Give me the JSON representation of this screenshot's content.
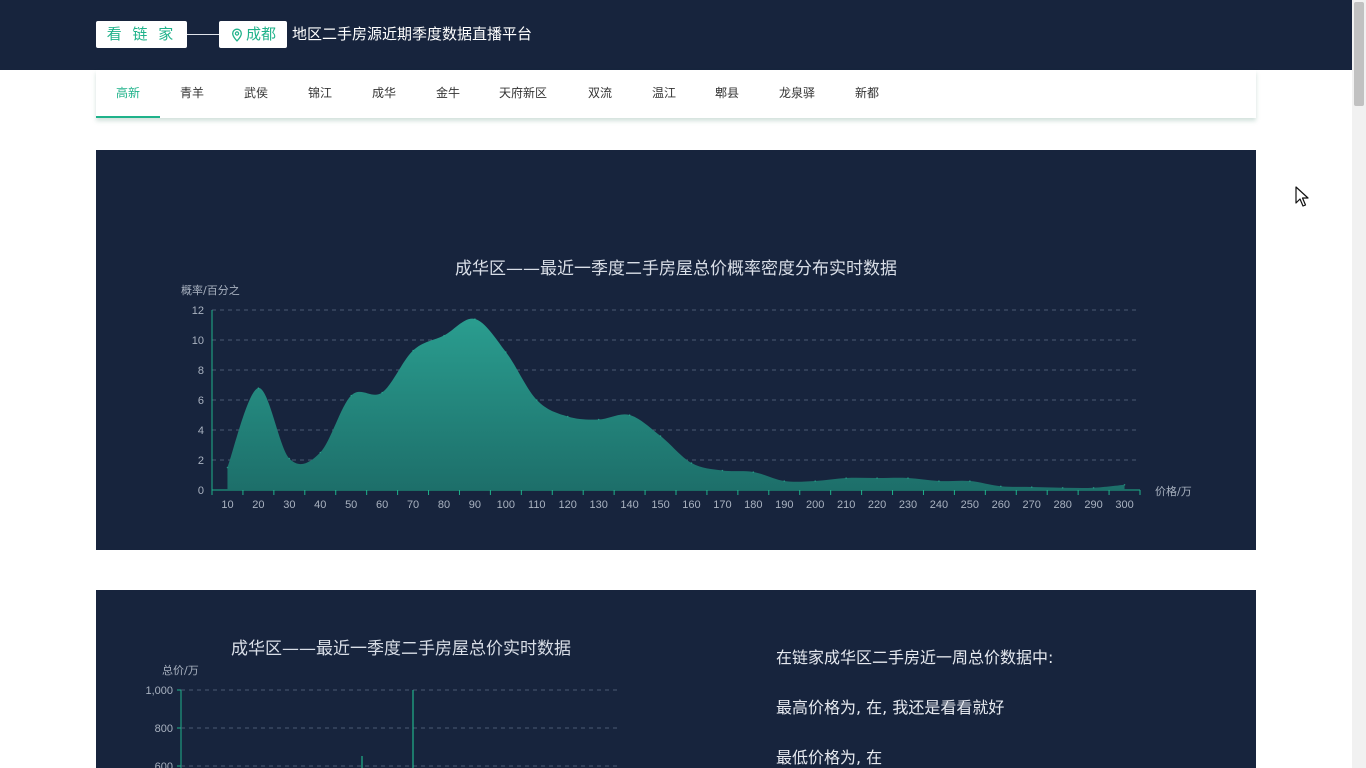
{
  "header": {
    "brand": "看 链 家",
    "city": "成都",
    "title": "地区二手房源近期季度数据直播平台",
    "city_icon": "location-pin-icon"
  },
  "district_tabs": [
    {
      "label": "高新",
      "active": true
    },
    {
      "label": "青羊",
      "active": false
    },
    {
      "label": "武侯",
      "active": false
    },
    {
      "label": "锦江",
      "active": false
    },
    {
      "label": "成华",
      "active": false
    },
    {
      "label": "金牛",
      "active": false
    },
    {
      "label": "天府新区",
      "active": false
    },
    {
      "label": "双流",
      "active": false
    },
    {
      "label": "温江",
      "active": false
    },
    {
      "label": "郫县",
      "active": false
    },
    {
      "label": "龙泉驿",
      "active": false
    },
    {
      "label": "新都",
      "active": false
    }
  ],
  "summary": {
    "line1": "在链家成华区二手房近一周总价数据中:",
    "line2": "最高价格为, 在, 我还是看看就好",
    "line3": "最低价格为, 在"
  },
  "colors": {
    "header_bg": "#17243d",
    "panel_bg": "#17243d",
    "accent": "#1fb28a",
    "area_top": "#2a9d8f",
    "area_bottom": "#1d6f6a"
  },
  "chart_data": [
    {
      "type": "area",
      "title": "成华区——最近一季度二手房屋总价概率密度分布实时数据",
      "ylabel": "概率/百分之",
      "xlabel": "价格/万",
      "x": [
        10,
        20,
        30,
        40,
        50,
        60,
        70,
        80,
        90,
        100,
        110,
        120,
        130,
        140,
        150,
        160,
        170,
        180,
        190,
        200,
        210,
        220,
        230,
        240,
        250,
        260,
        270,
        280,
        290,
        300
      ],
      "values": [
        1.5,
        6.8,
        2.1,
        2.5,
        6.3,
        6.5,
        9.3,
        10.3,
        11.4,
        9.2,
        6.0,
        4.9,
        4.7,
        5.0,
        3.6,
        1.8,
        1.3,
        1.2,
        0.6,
        0.6,
        0.8,
        0.8,
        0.8,
        0.6,
        0.6,
        0.25,
        0.2,
        0.15,
        0.15,
        0.35
      ],
      "ylim": [
        0,
        12
      ],
      "yticks": [
        0,
        2,
        4,
        6,
        8,
        10,
        12
      ],
      "grid": true
    },
    {
      "type": "bar",
      "title": "成华区——最近一季度二手房屋总价实时数据",
      "ylabel": "总价/万",
      "ylim": [
        0,
        1000
      ],
      "yticks": [
        "600",
        "800",
        "1,000"
      ],
      "grid": true
    }
  ]
}
